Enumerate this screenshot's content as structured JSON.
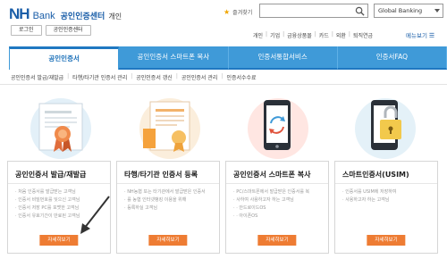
{
  "header": {
    "logo_nh": "NH",
    "logo_bank": "Bank",
    "logo_center": "공인인증센터",
    "logo_personal": "개인",
    "login_buttons": [
      "로그인",
      "공인인증센터"
    ],
    "favorites": "즐겨찾기",
    "search_placeholder": "",
    "global_banking": "Global Banking",
    "util_links": [
      "개인",
      "기업",
      "금융상품몰",
      "카드",
      "외환",
      "퇴직연금"
    ],
    "all_menu": "메뉴보기",
    "all_menu_icon": "hamburger-icon"
  },
  "tabs": [
    {
      "label": "공인인증서",
      "active": true
    },
    {
      "label": "공인인증서 스마트폰 복사",
      "active": false
    },
    {
      "label": "인증서통합서비스",
      "active": false
    },
    {
      "label": "인증서FAQ",
      "active": false
    }
  ],
  "subnav": [
    "공인인증서 발급/재발급",
    "타행/타기관 인증서 관리",
    "공인인증서 갱신",
    "공인인증서 관리",
    "인증서수수료"
  ],
  "cards": [
    {
      "title": "공인인증서 발급/재발급",
      "items": [
        "처음 인증서를 발급받는 고객님",
        "인증서 비밀번호를 잊으신 고객님",
        "인증서 저장 PC를 포맷한 고객님",
        "인증서 유효기간이 만료된 고객님"
      ],
      "button": "자세히보기",
      "icon": "certificate-award-icon"
    },
    {
      "title": "타행/타기관 인증서 등록",
      "items": [
        "NH농협 또는 타기관에서 발급받은 인증서",
        "를 농협 인터넷뱅킹 이용을 위해",
        "등록하실 고객님"
      ],
      "button": "자세히보기",
      "icon": "document-ribbon-icon"
    },
    {
      "title": "공인인증서 스마트폰 복사",
      "items": [
        "PC/스마트폰에서 발급받은 인증서를 복",
        "사하여 사용하고자 하는 고객님",
        "· 안드로이드OS",
        "· 아이폰OS"
      ],
      "button": "자세히보기",
      "icon": "smartphone-sync-icon"
    },
    {
      "title": "스마트인증서(USIM)",
      "items": [
        "인증서를 USIM에 저장하여",
        "사용하고자 하는 고객님"
      ],
      "button": "자세히보기",
      "icon": "smartphone-lock-icon"
    }
  ],
  "colors": {
    "brand_blue": "#1a5ea8",
    "tab_blue": "#3f9ad8",
    "button_orange": "#ee7c33"
  }
}
